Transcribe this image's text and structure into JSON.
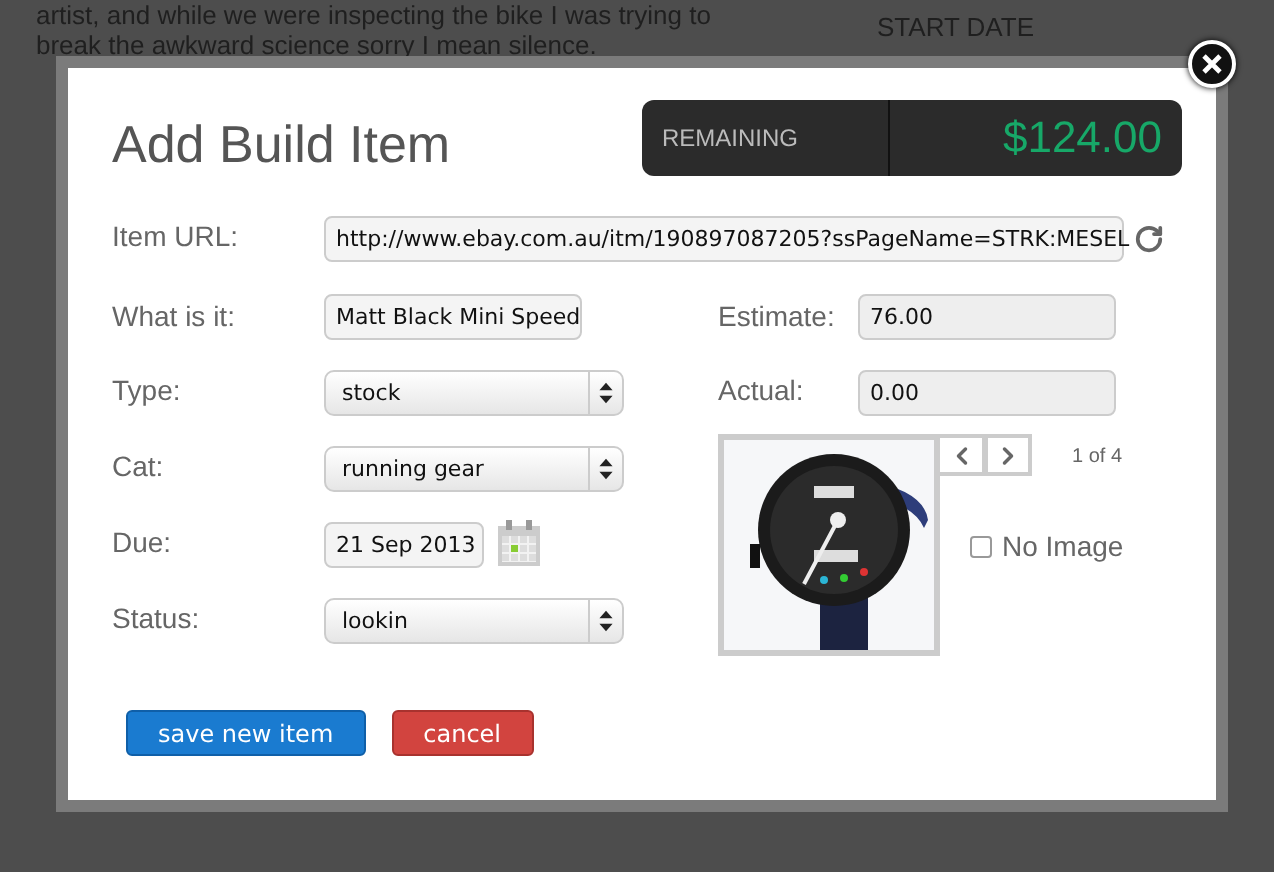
{
  "background": {
    "paragraph_lines": [
      "artist, and while we were inspecting the bike I was trying to",
      "break the awkward science sorry I mean silence."
    ],
    "start_date_label": "START DATE"
  },
  "dialog": {
    "title": "Add Build Item",
    "remaining": {
      "label": "REMAINING",
      "amount": "$124.00"
    },
    "url_field": {
      "label": "Item URL:",
      "value": "http://www.ebay.com.au/itm/190897087205?ssPageName=STRK:MESEL"
    },
    "left_fields": [
      {
        "label": "What is it:",
        "kind": "text",
        "value": "Matt Black Mini Speed"
      },
      {
        "label": "Type:",
        "kind": "select",
        "value": "stock"
      },
      {
        "label": "Cat:",
        "kind": "select",
        "value": "running gear"
      },
      {
        "label": "Due:",
        "kind": "date",
        "value": "21 Sep 2013"
      },
      {
        "label": "Status:",
        "kind": "select",
        "value": "lookin"
      }
    ],
    "right_fields": [
      {
        "label": "Estimate:",
        "value": "76.00"
      },
      {
        "label": "Actual:",
        "value": "0.00"
      }
    ],
    "image": {
      "kind": "picture",
      "counter": "1 of 4",
      "no_image": {
        "label": "No Image",
        "checked": false
      }
    },
    "buttons": [
      {
        "label": "save new item",
        "kind": "primary"
      },
      {
        "label": "cancel",
        "kind": "danger"
      }
    ]
  }
}
